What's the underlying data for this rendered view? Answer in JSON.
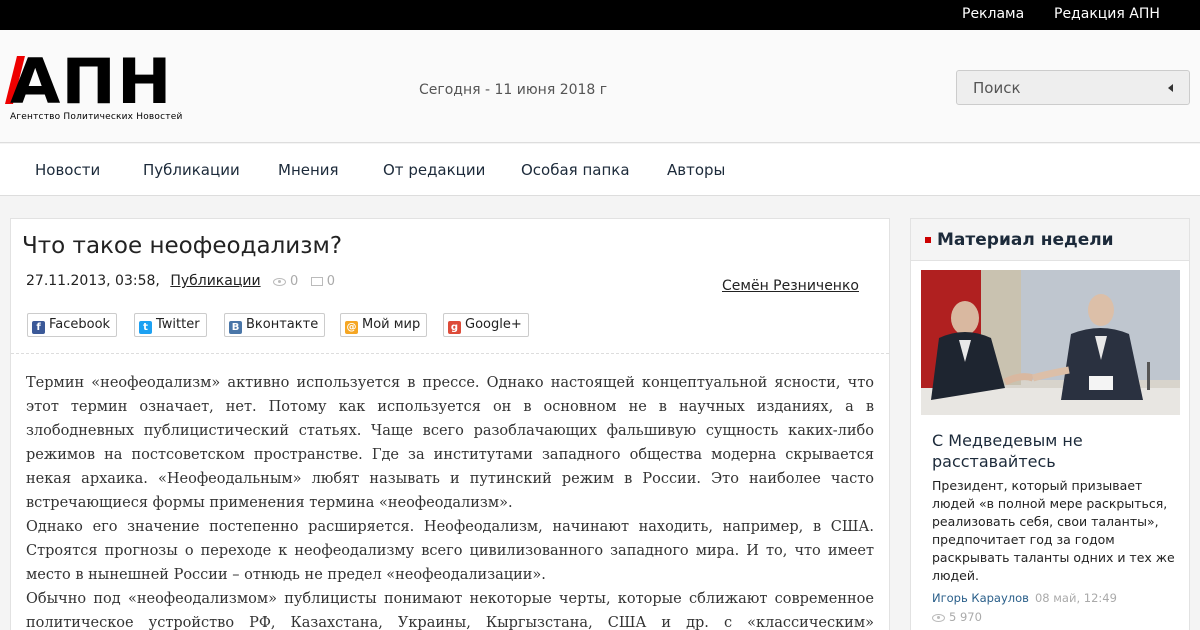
{
  "topbar": {
    "ad": "Реклама",
    "editorial": "Редакция АПН"
  },
  "logo": {
    "mark": "АПН",
    "tagline": "Агентство Политических Новостей"
  },
  "header": {
    "today": "Сегодня - 11 июня 2018 г"
  },
  "search": {
    "placeholder": "Поиск"
  },
  "nav": [
    "Новости",
    "Публикации",
    "Мнения",
    "От редакции",
    "Особая папка",
    "Авторы"
  ],
  "article": {
    "title": "Что такое неофеодализм?",
    "datetime": "27.11.2013, 03:58,",
    "category": "Публикации",
    "views": "0",
    "comments": "0",
    "author": "Семён Резниченко",
    "share": [
      "Facebook",
      "Twitter",
      "Вконтакте",
      "Мой мир",
      "Google+"
    ],
    "paragraphs": [
      "Термин «неофеодализм» активно используется в прессе. Однако настоящей концептуальной ясности, что этот термин означает, нет. Потому как используется он в основном не в научных изданиях, а в злободневных публицистический статьях. Чаще всего разоблачающих фальшивую сущность каких-либо режимов на постсоветском пространстве. Где за институтами западного общества модерна скрывается некая архаика. «Неофеодальным» любят называть и путинский режим в России. Это наиболее часто встречающиеся формы применения термина «неофеодализм».",
      "Однако его значение постепенно расширяется. Неофеодализм, начинают находить, например, в США. Строятся прогнозы о переходе к неофеодализму всего цивилизованного западного мира. И то, что имеет место в нынешней России – отнюдь не предел «неофеодализации».",
      "Обычно под «неофеодализмом» публицисты понимают некоторые черты, которые сближают современное политическое устройство РФ, Казахстана, Украины, Кыргызстана, США и др. с «классическим» феодализмом."
    ]
  },
  "sidebar": {
    "heading": "Материал недели",
    "title": "С Медведевым не расставайтесь",
    "description": "Президент, который призывает людей «в полной мере раскрыться, реализовать себя, свои таланты», предпочитает год за годом раскрывать таланты одних и тех же людей.",
    "author": "Игорь Караулов",
    "date": "08 май, 12:49",
    "views": "5 970"
  },
  "colors": {
    "accent": "#e00000",
    "nav_text": "#1c2a3a",
    "link": "#2a5f8a"
  },
  "icons": [
    "eye-icon",
    "comment-icon",
    "facebook-icon",
    "twitter-icon",
    "vk-icon",
    "mymir-icon",
    "googleplus-icon",
    "chevron-left-icon"
  ]
}
